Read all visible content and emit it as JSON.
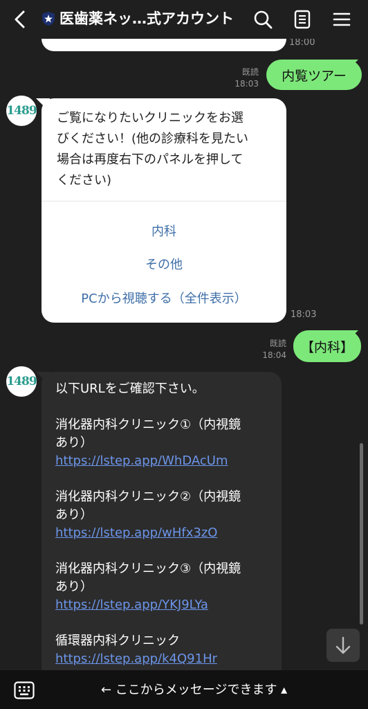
{
  "header": {
    "title": "医歯薬ネッ…式アカウント"
  },
  "messages": {
    "prev_time": "18:00",
    "user1": {
      "text": "内覧ツアー",
      "read": "既読",
      "time": "18:03"
    },
    "bot1": {
      "avatar": "1489",
      "text_lines": [
        "ご覧になりたいクリニックをお選",
        "びください！(他の診療科を見たい",
        "場合は再度右下のパネルを押して",
        "ください)"
      ],
      "options": [
        "内科",
        "その他",
        "PCから視聴する（全件表示）"
      ],
      "time": "18:03"
    },
    "user2": {
      "text": "【内科】",
      "read": "既読",
      "time": "18:04"
    },
    "bot2": {
      "avatar": "1489",
      "intro": "以下URLをご確認下さい。",
      "items": [
        {
          "line1": "消化器内科クリニック①（内視鏡",
          "line2": "あり）",
          "url": "https://lstep.app/WhDAcUm"
        },
        {
          "line1": "消化器内科クリニック②（内視鏡",
          "line2": "あり）",
          "url": "https://lstep.app/wHfx3zO"
        },
        {
          "line1": "消化器内科クリニック③（内視鏡",
          "line2": "あり）",
          "url": "https://lstep.app/YKJ9LYa"
        },
        {
          "line1": "循環器内科クリニック",
          "url": "https://lstep.app/k4Q91Hr"
        }
      ]
    }
  },
  "footer": {
    "input_text": "← ここからメッセージできます ▴"
  },
  "colors": {
    "accent_green": "#7de87a",
    "link": "#6c95ea",
    "option_blue": "#3f6fa8"
  }
}
